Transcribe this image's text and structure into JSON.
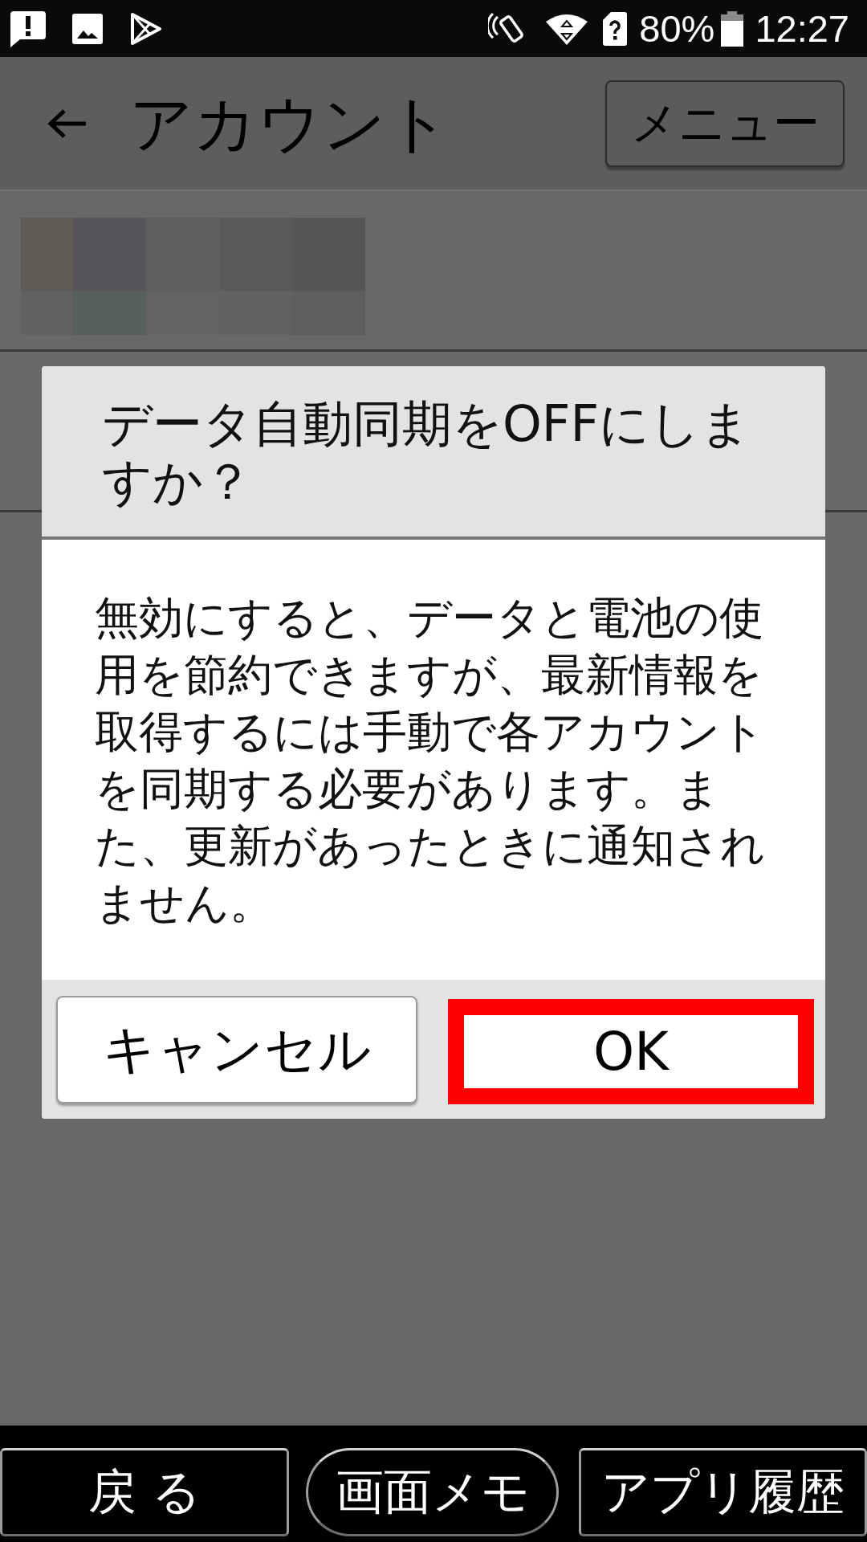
{
  "status_bar": {
    "battery_percent": "80%",
    "time": "12:27"
  },
  "header": {
    "title": "アカウント",
    "menu_button": "メニュー"
  },
  "dialog": {
    "title": "データ自動同期をOFFにしますか？",
    "message": "無効にすると、データと電池の使用を節約できますが、最新情報を取得するには手動で各アカウントを同期する必要があります。また、更新があったときに通知されません。",
    "buttons": [
      {
        "label": "キャンセル",
        "highlighted": false
      },
      {
        "label": "OK",
        "highlighted": true
      }
    ]
  },
  "nav_bar": {
    "buttons": [
      {
        "label": "戻 る",
        "kind": "rect"
      },
      {
        "label": "画面メモ",
        "kind": "pill"
      },
      {
        "label": "アプリ履歴",
        "kind": "rect"
      }
    ]
  }
}
